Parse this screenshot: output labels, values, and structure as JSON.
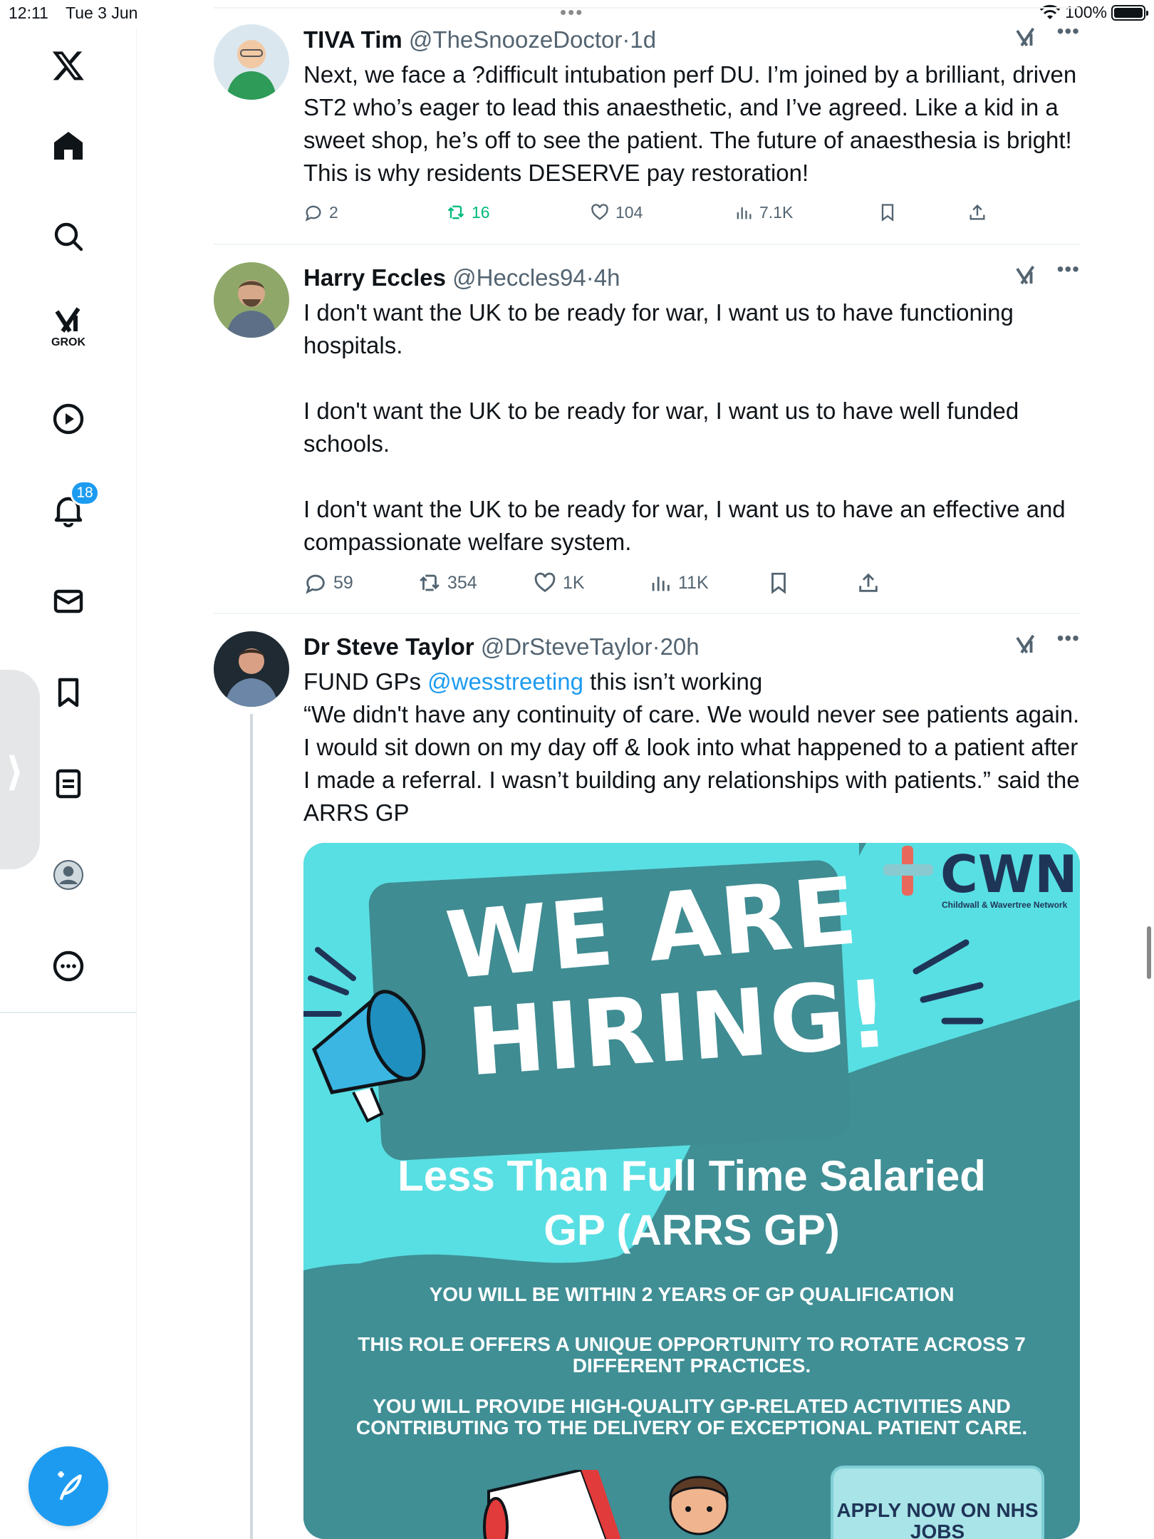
{
  "status": {
    "time": "12:11",
    "date": "Tue 3 Jun",
    "battery": "100%",
    "multitask": "•••"
  },
  "sidebar": {
    "items": [
      {
        "name": "x-logo",
        "icon": "x-logo-icon"
      },
      {
        "name": "home",
        "icon": "home-icon"
      },
      {
        "name": "explore",
        "icon": "search-icon"
      },
      {
        "name": "grok",
        "icon": "grok-icon",
        "label": "GROK"
      },
      {
        "name": "video",
        "icon": "play-icon"
      },
      {
        "name": "notifications",
        "icon": "bell-icon",
        "badge": "18"
      },
      {
        "name": "messages",
        "icon": "mail-icon"
      },
      {
        "name": "bookmarks",
        "icon": "bookmark-icon"
      },
      {
        "name": "lists",
        "icon": "list-icon"
      },
      {
        "name": "profile",
        "icon": "avatar-icon"
      },
      {
        "name": "more",
        "icon": "more-circle-icon"
      }
    ],
    "collapse_handle": "⟩"
  },
  "tweets": [
    {
      "name": "TIVA Tim",
      "handle": "@TheSnoozeDoctor",
      "sep": "·",
      "time": "1d",
      "text": "Next, we face a ?difficult intubation perf DU. I’m joined by a brilliant, driven ST2 who’s eager to lead this anaesthetic, and I’ve agreed. Like a kid in a sweet shop, he’s off to see the patient. The future of anaesthesia is bright! This is why residents DESERVE pay restoration!",
      "replies": "2",
      "retweets": "16",
      "likes": "104",
      "views": "7.1K"
    },
    {
      "name": "Harry Eccles",
      "handle": "@Heccles94",
      "sep": "·",
      "time": "4h",
      "paragraphs": [
        "I don't want the UK to be ready for war, I want us to have functioning hospitals.",
        "I don't want the UK to be ready for war, I want us to have well funded schools.",
        "I don't want the UK to be ready for war, I want us to have an effective and compassionate welfare system."
      ],
      "replies": "59",
      "retweets": "354",
      "likes": "1K",
      "views": "11K"
    },
    {
      "name": "Dr Steve Taylor",
      "handle": "@DrSteveTaylor",
      "sep": "·",
      "time": "20h",
      "text_pre": "FUND GPs ",
      "mention": "@wesstreeting",
      "text_post": " this isn’t working",
      "quote": "“We didn't have any continuity of care. We would never see patients again. I would sit down on my day off & look into what happened to a patient after I made a referral. I wasn’t building any relationships with patients.” said the ARRS GP",
      "image": {
        "logo": "CWN",
        "logo_sub": "Childwall & Wavertree Network",
        "headline_1": "WE ARE",
        "headline_2": "HIRING!",
        "subtitle_1": "Less Than Full Time Salaried",
        "subtitle_2": "GP (ARRS GP)",
        "line_1": "YOU WILL BE WITHIN 2 YEARS OF GP QUALIFICATION",
        "line_2a": "THIS ROLE OFFERS A UNIQUE OPPORTUNITY TO ROTATE ACROSS 7",
        "line_2b": "DIFFERENT PRACTICES.",
        "line_3a": "YOU WILL PROVIDE HIGH-QUALITY GP-RELATED ACTIVITIES AND",
        "line_3b": "CONTRIBUTING TO THE DELIVERY OF EXCEPTIONAL PATIENT CARE.",
        "apply": "APPLY NOW ON NHS JOBS"
      }
    }
  ],
  "colors": {
    "accent": "#1d9bf0",
    "retweet_green": "#00ba7c",
    "muted": "#536471",
    "promo_teal": "#3f8f95",
    "promo_cyan": "#58dfe3",
    "promo_navy": "#1f3558"
  }
}
